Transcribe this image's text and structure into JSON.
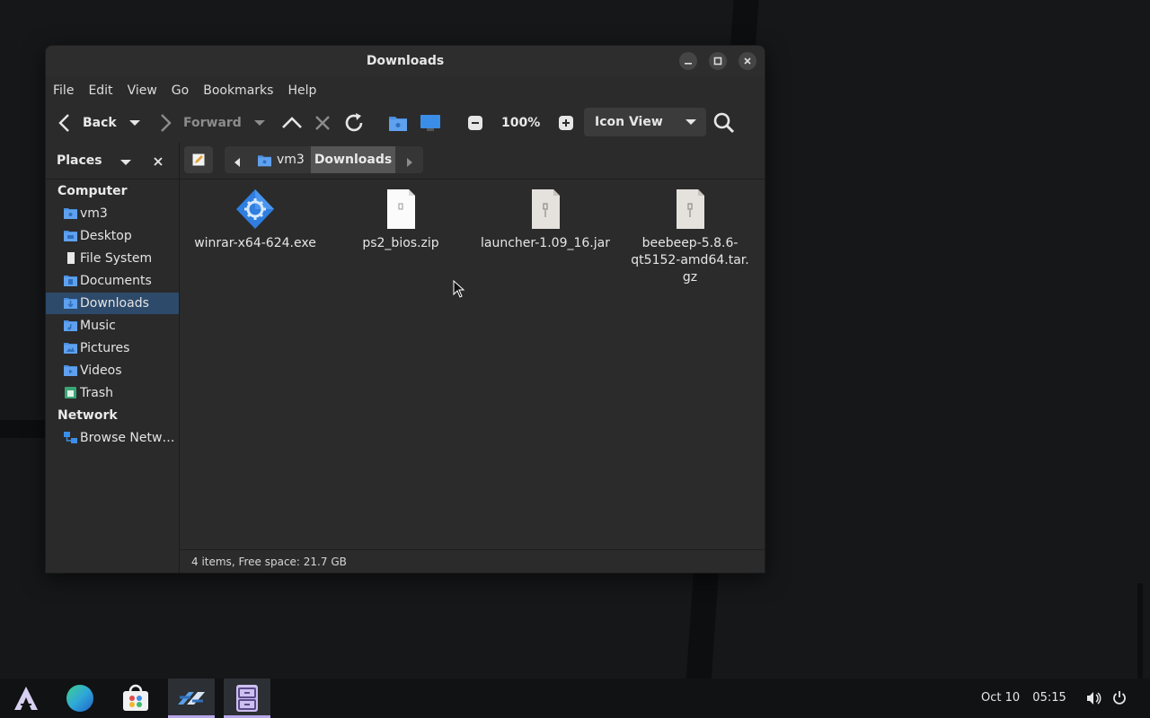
{
  "window": {
    "title": "Downloads"
  },
  "menubar": [
    "File",
    "Edit",
    "View",
    "Go",
    "Bookmarks",
    "Help"
  ],
  "toolbar": {
    "back_label": "Back",
    "forward_label": "Forward",
    "zoom_level": "100%",
    "view_mode": "Icon View"
  },
  "sidebar": {
    "header": "Places",
    "sections": {
      "computer": "Computer",
      "network": "Network"
    },
    "items": [
      {
        "label": "vm3",
        "icon": "home-folder-icon"
      },
      {
        "label": "Desktop",
        "icon": "desktop-folder-icon"
      },
      {
        "label": "File System",
        "icon": "drive-icon"
      },
      {
        "label": "Documents",
        "icon": "documents-folder-icon"
      },
      {
        "label": "Downloads",
        "icon": "downloads-folder-icon",
        "active": true
      },
      {
        "label": "Music",
        "icon": "music-folder-icon"
      },
      {
        "label": "Pictures",
        "icon": "pictures-folder-icon"
      },
      {
        "label": "Videos",
        "icon": "videos-folder-icon"
      },
      {
        "label": "Trash",
        "icon": "trash-icon"
      }
    ],
    "network_items": [
      {
        "label": "Browse Netw…",
        "icon": "network-icon"
      }
    ]
  },
  "breadcrumb": {
    "parent": "vm3",
    "current": "Downloads"
  },
  "files": [
    {
      "name": "winrar-x64-624.exe",
      "icon": "executable-icon"
    },
    {
      "name": "ps2_bios.zip",
      "icon": "zip-archive-icon"
    },
    {
      "name": "launcher-1.09_16.jar",
      "icon": "jar-archive-icon"
    },
    {
      "name": "beebeep-5.8.6-qt5152-amd64.tar.gz",
      "lines": [
        "beebeep-5.8.6-",
        "qt5152-amd64.tar.",
        "gz"
      ],
      "icon": "tar-archive-icon"
    }
  ],
  "status": {
    "text": "4 items, Free space: 21.7 GB"
  },
  "taskbar": {
    "date": "Oct 10",
    "time": "05:15",
    "apps": [
      "app-menu-icon",
      "browser-icon",
      "software-store-icon",
      "settings-app-icon",
      "file-manager-icon"
    ]
  },
  "colors": {
    "accent": "#2d4a6a",
    "folder_blue": "#4a8fe0",
    "taskbar_highlight": "#b7a6ea"
  }
}
